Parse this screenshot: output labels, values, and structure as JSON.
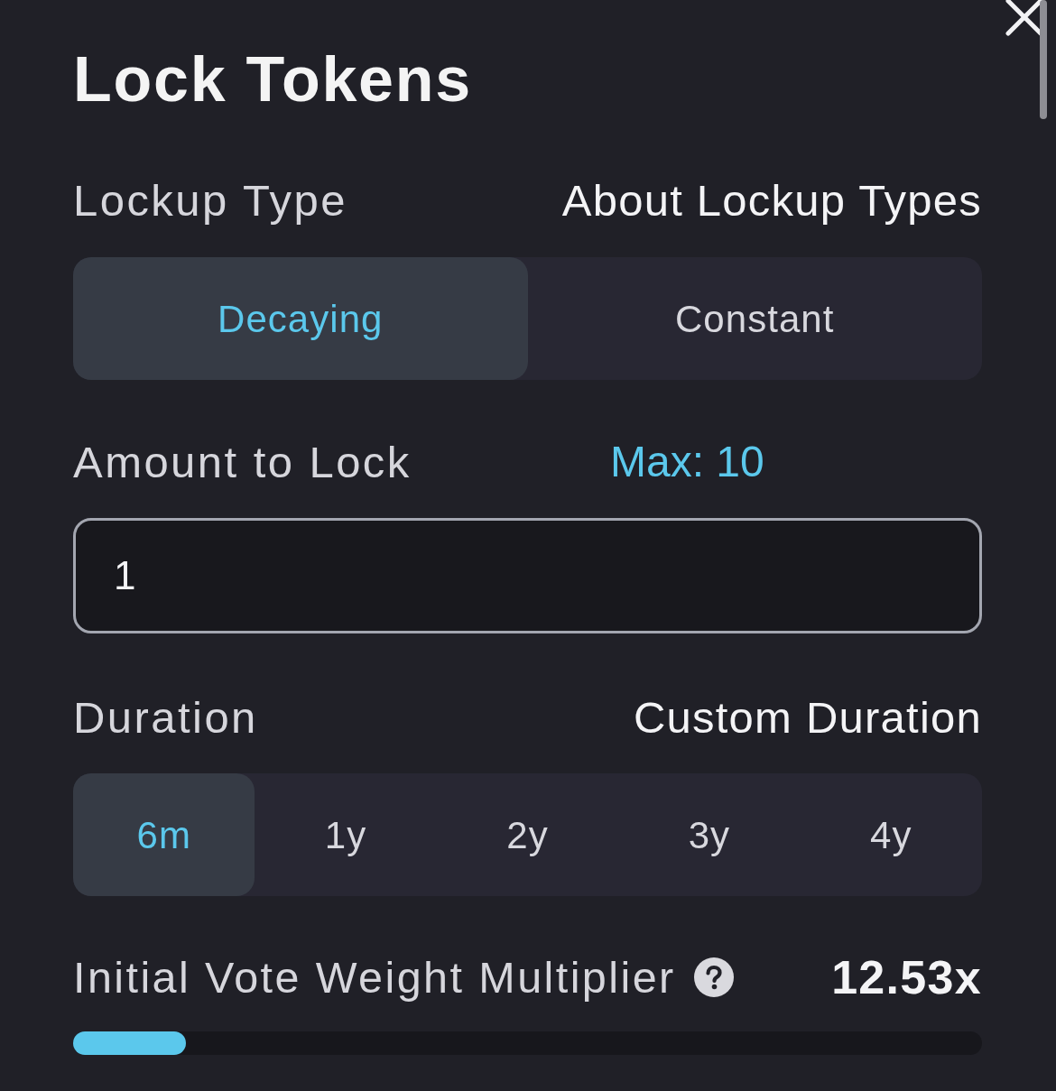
{
  "dialog": {
    "title": "Lock Tokens"
  },
  "lockup_type": {
    "label": "Lockup Type",
    "link": "About Lockup Types",
    "options": [
      {
        "label": "Decaying",
        "selected": true
      },
      {
        "label": "Constant",
        "selected": false
      }
    ]
  },
  "amount": {
    "label": "Amount to Lock",
    "max": "Max: 10",
    "value": "1"
  },
  "duration": {
    "label": "Duration",
    "link": "Custom Duration",
    "options": [
      {
        "label": "6m",
        "selected": true
      },
      {
        "label": "1y",
        "selected": false
      },
      {
        "label": "2y",
        "selected": false
      },
      {
        "label": "3y",
        "selected": false
      },
      {
        "label": "4y",
        "selected": false
      }
    ]
  },
  "multiplier": {
    "label": "Initial Vote Weight Multiplier",
    "value": "12.53x",
    "level": 0.124
  }
}
